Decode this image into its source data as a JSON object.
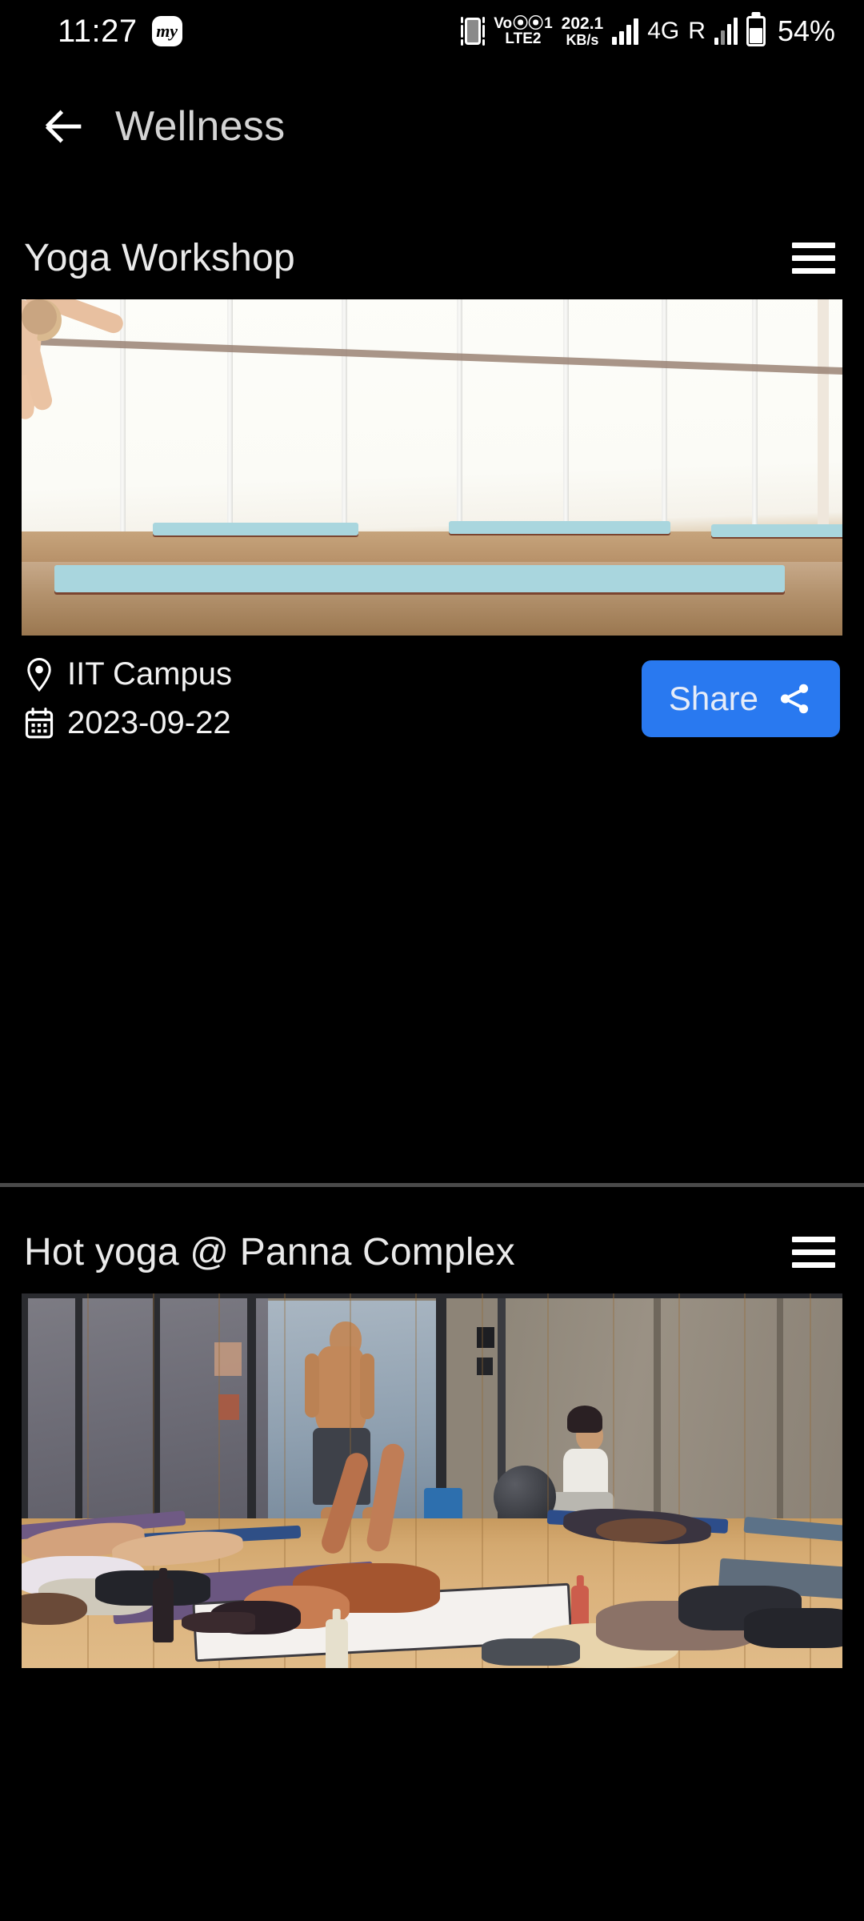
{
  "status_bar": {
    "time": "11:27",
    "app_icon": "my-app-icon",
    "vibrate_icon": "vibrate-icon",
    "volte": {
      "line1": "Vo",
      "arc": ")))",
      "sim1": "1",
      "line2": "LTE2"
    },
    "net_speed": {
      "value": "202.1",
      "unit": "KB/s"
    },
    "signal_icon": "signal-bars-icon",
    "network_type": "4G",
    "roaming": "R",
    "signal2_icon": "signal-bars-2-icon",
    "battery_icon": "battery-icon",
    "battery_percent": "54%"
  },
  "app_bar": {
    "back_icon": "arrow-left-icon",
    "title": "Wellness"
  },
  "cards": [
    {
      "title": "Yoga Workshop",
      "menu_icon": "hamburger-menu-icon",
      "image_alt": "Yoga class doing eagle arms seated on blue mats in a bright studio",
      "location_icon": "location-pin-icon",
      "location": "IIT Campus",
      "date_icon": "calendar-icon",
      "date": "2023-09-22",
      "share_label": "Share",
      "share_icon": "share-icon"
    },
    {
      "title": "Hot yoga @ Panna Complex",
      "menu_icon": "hamburger-menu-icon",
      "image_alt": "Hot yoga class with instructor standing, students lying on mats on a wooden floor"
    }
  ],
  "colors": {
    "background": "#000000",
    "title_text": "#d4d4d4",
    "card_title_text": "#eaeaea",
    "share_button": "#2979f0",
    "share_text": "#e6ecf8",
    "divider": "#4a4a4a",
    "icon_white": "#ffffff"
  }
}
